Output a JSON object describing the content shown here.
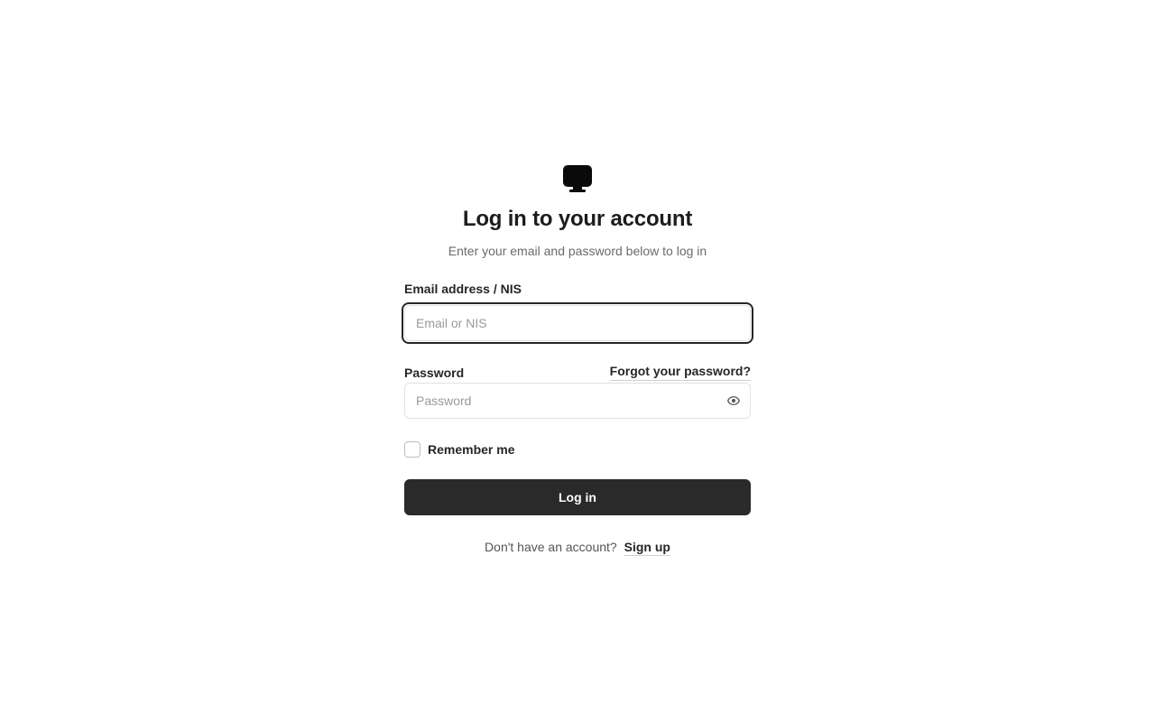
{
  "app": {
    "logo_icon": "monitor-icon"
  },
  "header": {
    "title": "Log in to your account",
    "subtitle": "Enter your email and password below to log in"
  },
  "form": {
    "email": {
      "label": "Email address / NIS",
      "placeholder": "Email or NIS",
      "value": ""
    },
    "password": {
      "label": "Password",
      "placeholder": "Password",
      "value": "",
      "toggle_icon": "eye-icon"
    },
    "forgot_password_label": "Forgot your password?",
    "remember_me_label": "Remember me",
    "remember_me_checked": false,
    "submit_label": "Log in"
  },
  "footer": {
    "signup_prompt": "Don't have an account?",
    "signup_label": "Sign up"
  },
  "colors": {
    "primary_button": "#2a2a2a",
    "text": "#262626",
    "muted_text": "#6b6b6b",
    "border": "#e2e2e2"
  }
}
